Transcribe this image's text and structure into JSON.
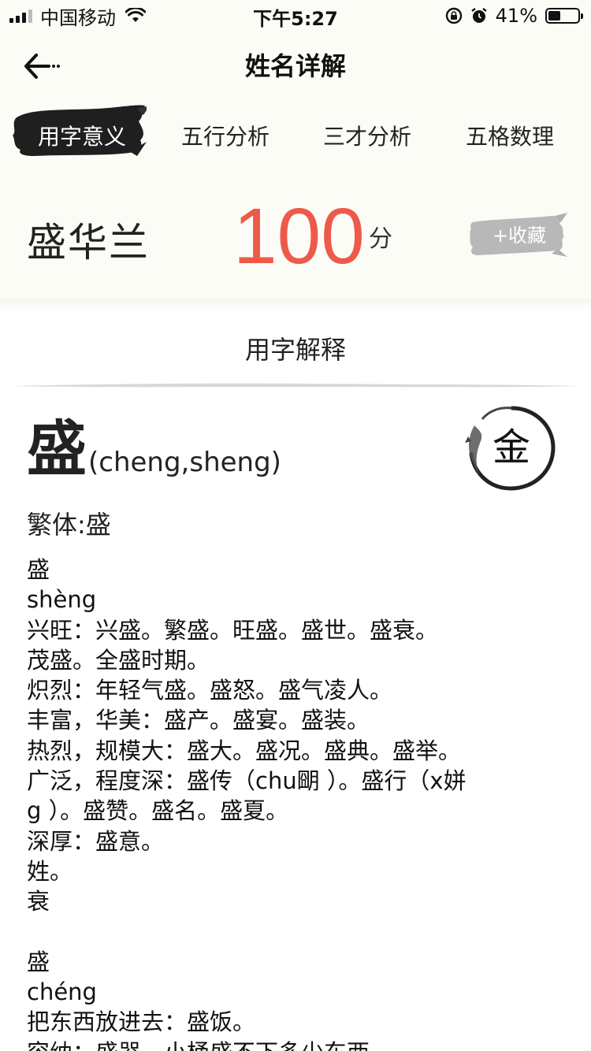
{
  "status_bar": {
    "carrier": "中国移动",
    "time": "下午5:27",
    "battery_percent": "41%",
    "battery_level": 0.41,
    "icons": [
      "signal-icon",
      "wifi-icon",
      "rotation-lock-icon",
      "alarm-icon",
      "battery-icon"
    ]
  },
  "header": {
    "title": "姓名详解",
    "back_icon": "back-arrow-icon"
  },
  "tabs": [
    {
      "label": "用字意义",
      "active": true
    },
    {
      "label": "五行分析",
      "active": false
    },
    {
      "label": "三才分析",
      "active": false
    },
    {
      "label": "五格数理",
      "active": false
    }
  ],
  "score_card": {
    "name": "盛华兰",
    "score": "100",
    "unit": "分",
    "favorite_label": "+收藏"
  },
  "section": {
    "title": "用字解释"
  },
  "character": {
    "char": "盛",
    "pinyin": "(cheng,sheng)",
    "element": "金",
    "traditional": "繁体:盛"
  },
  "explanation_lines": [
    "盛",
    "shèng",
    "兴旺：兴盛。繁盛。旺盛。盛世。盛衰。",
    "茂盛。全盛时期。",
    "炽烈：年轻气盛。盛怒。盛气凌人。",
    "丰富，华美：盛产。盛宴。盛装。",
    "热烈，规模大：盛大。盛况。盛典。盛举。",
    "广泛，程度深：盛传（chu朙 ）。盛行（x姘",
    "g ）。盛赞。盛名。盛夏。",
    "深厚：盛意。",
    "姓。",
    "衰",
    "",
    "盛",
    "chéng",
    "把东西放进去：盛饭。",
    "容纳：盛器。小桶盛不下多少东西。"
  ],
  "colors": {
    "background": "#fcfcf7",
    "score_red": "#ee5a4a",
    "ink_black": "#1f1f1f",
    "fav_gray": "#b8b8b8"
  }
}
